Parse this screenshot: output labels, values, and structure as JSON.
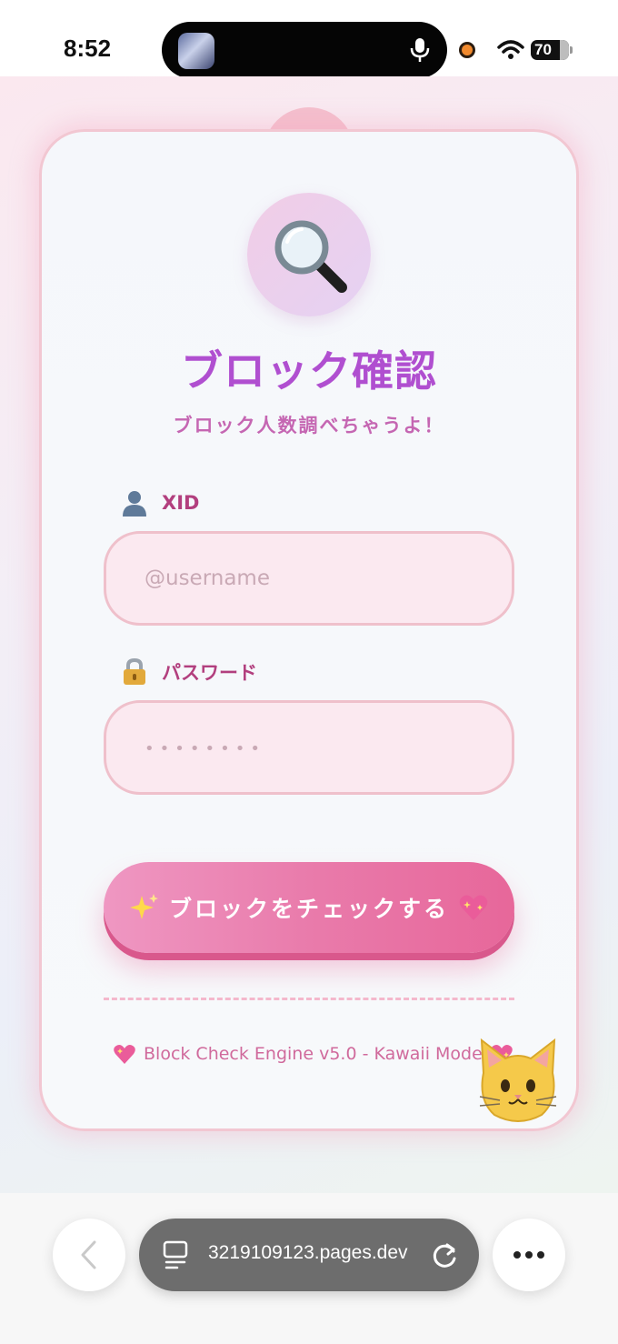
{
  "status_bar": {
    "time": "8:52",
    "battery": "70"
  },
  "form": {
    "title": "ブロック確認",
    "subtitle": "ブロック人数調べちゃうよ！",
    "xid_label": "XID",
    "xid_placeholder": "@username",
    "password_label": "パスワード",
    "password_placeholder": "••••••••",
    "submit_label": "ブロックをチェックする"
  },
  "footer": {
    "text": "Block Check Engine v5.0 - Kawaii Mode"
  },
  "browser": {
    "url": "3219109123.pages.dev"
  },
  "icons": {
    "search": "magnifier-icon",
    "user": "user-silhouette-icon",
    "lock": "lock-icon",
    "sparkles": "sparkles-icon",
    "heart": "sparkling-heart-icon",
    "cat": "cat-face-icon"
  },
  "colors": {
    "title": "#b04fd0",
    "accent_pink": "#e97bab",
    "label": "#b23f7e",
    "input_bg": "#fbe9f0"
  }
}
